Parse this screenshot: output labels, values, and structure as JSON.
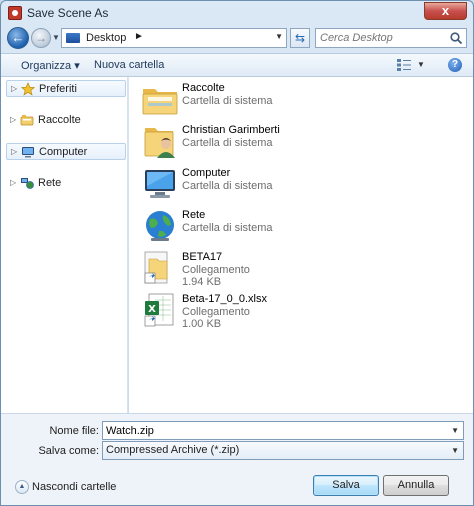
{
  "window": {
    "title": "Save Scene As",
    "close_label": "x"
  },
  "address": {
    "location": "Desktop",
    "search_placeholder": "Cerca Desktop"
  },
  "toolbar": {
    "organize": "Organizza ▾",
    "new_folder": "Nuova cartella"
  },
  "nav": {
    "items": [
      {
        "label": "Preferiti",
        "icon": "star-icon"
      },
      {
        "label": "Raccolte",
        "icon": "libraries-icon"
      },
      {
        "label": "Computer",
        "icon": "computer-icon"
      },
      {
        "label": "Rete",
        "icon": "network-icon"
      }
    ]
  },
  "files": [
    {
      "name": "Raccolte",
      "type": "Cartella di sistema",
      "size": "",
      "icon": "libraries-folder-icon"
    },
    {
      "name": "Christian Garimberti",
      "type": "Cartella di sistema",
      "size": "",
      "icon": "user-folder-icon"
    },
    {
      "name": "Computer",
      "type": "Cartella di sistema",
      "size": "",
      "icon": "computer-icon"
    },
    {
      "name": "Rete",
      "type": "Cartella di sistema",
      "size": "",
      "icon": "network-globe-icon"
    },
    {
      "name": "BETA17",
      "type": "Collegamento",
      "size": "1.94 KB",
      "icon": "folder-shortcut-icon"
    },
    {
      "name": "Beta-17_0_0.xlsx",
      "type": "Collegamento",
      "size": "1.00 KB",
      "icon": "excel-shortcut-icon"
    }
  ],
  "form": {
    "filename_label": "Nome file:",
    "filename_value": "Watch.zip",
    "saveas_label": "Salva come:",
    "saveas_value": "Compressed Archive (*.zip)"
  },
  "footer": {
    "hide_folders": "Nascondi cartelle",
    "save": "Salva",
    "cancel": "Annulla"
  },
  "colors": {
    "accent": "#3c7fb1",
    "close": "#c75050",
    "folder": "#f3cf6b"
  }
}
